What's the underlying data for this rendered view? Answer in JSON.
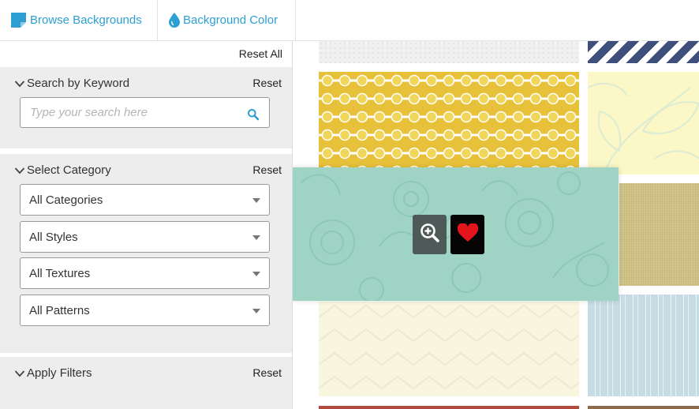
{
  "tabs": {
    "browse": {
      "label": "Browse Backgrounds",
      "icon": "note-icon",
      "color": "#2d9fd2"
    },
    "color": {
      "label": "Background Color",
      "icon": "droplet-icon",
      "color": "#2d9fd2"
    }
  },
  "sidebar": {
    "reset_all": "Reset All",
    "keyword": {
      "title": "Search by Keyword",
      "reset": "Reset",
      "placeholder": "Type your search here"
    },
    "category": {
      "title": "Select Category",
      "reset": "Reset",
      "selects": [
        {
          "value": "All Categories"
        },
        {
          "value": "All Styles"
        },
        {
          "value": "All Textures"
        },
        {
          "value": "All Patterns"
        }
      ]
    },
    "apply": {
      "title": "Apply Filters",
      "reset": "Reset"
    }
  },
  "gallery": {
    "hover_actions": {
      "zoom_icon": "zoom-in-icon",
      "favorite_icon": "heart-icon"
    },
    "tile_colors": {
      "gray": "#f1f0f0",
      "navy_stripes": "#3d4f7a",
      "yellow_dots": "#e8c13a",
      "cream_leaves": "#fbf7c6",
      "teal_floral": "#9fd4c5",
      "olive_linen": "#cfc184",
      "light_yellow_chevron": "#f8f6df",
      "blue_stripes": "#c6dce4",
      "red": "#b14a3f",
      "brown": "#8c6a4c"
    }
  }
}
